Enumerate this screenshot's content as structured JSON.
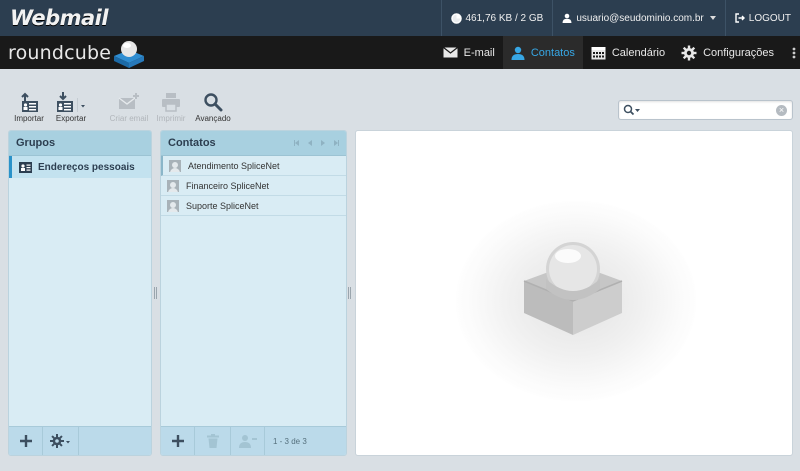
{
  "header": {
    "brand": "Webmail",
    "quota": "461,76 KB / 2 GB",
    "user": "usuario@seudominio.com.br",
    "logout": "LOGOUT"
  },
  "nav": {
    "logo_text": "roundcube",
    "items": [
      {
        "label": "E-mail",
        "icon": "envelope-icon",
        "active": false
      },
      {
        "label": "Contatos",
        "icon": "person-icon",
        "active": true
      },
      {
        "label": "Calendário",
        "icon": "calendar-icon",
        "active": false
      },
      {
        "label": "Configurações",
        "icon": "gear-icon",
        "active": false
      }
    ]
  },
  "toolbar": {
    "import": "Importar",
    "export": "Exportar",
    "compose": "Criar email",
    "print": "Imprimir",
    "advanced": "Avançado"
  },
  "search": {
    "placeholder": ""
  },
  "groups": {
    "title": "Grupos",
    "items": [
      {
        "label": "Endereços pessoais",
        "selected": true
      }
    ]
  },
  "contacts": {
    "title": "Contatos",
    "items": [
      {
        "name": "Atendimento SpliceNet"
      },
      {
        "name": "Financeiro SpliceNet"
      },
      {
        "name": "Suporte SpliceNet"
      }
    ],
    "count": "1 - 3 de 3"
  },
  "colors": {
    "topbar": "#2c3e50",
    "navbar": "#191919",
    "accent": "#37a7e5",
    "panel": "#d9ecf4",
    "panel_header": "#a8d0e0"
  }
}
